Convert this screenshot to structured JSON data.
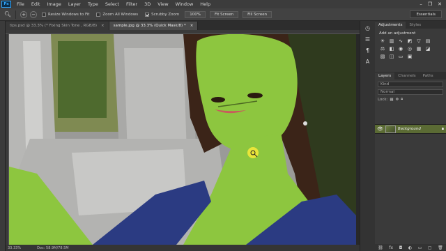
{
  "menu": {
    "logo": "Ps",
    "items": [
      "File",
      "Edit",
      "Image",
      "Layer",
      "Type",
      "Select",
      "Filter",
      "3D",
      "View",
      "Window",
      "Help"
    ],
    "window_controls": [
      "–",
      "❐",
      "✕"
    ]
  },
  "options": {
    "resize_windows": "Resize Windows to Fit",
    "zoom_all": "Zoom All Windows",
    "scrubby_zoom": "Scrubby Zoom",
    "btn_100": "100%",
    "fit_screen": "Fit Screen",
    "fill_screen": "Fill Screen",
    "workspace": "Essentials"
  },
  "tabs": [
    {
      "label": "tips.psd @ 33.3% (* Fixing Skin Tone , RGB/8)",
      "close": "×"
    },
    {
      "label": "sample.jpg @ 33.3% (Quick Mask/8) *",
      "close": "×"
    }
  ],
  "status": {
    "zoom": "33.33%",
    "doc": "Doc: 58.9M/78.5M"
  },
  "panels": {
    "adj_tabs": [
      "Adjustments",
      "Styles"
    ],
    "adj_title": "Add an adjustment",
    "layer_tabs": [
      "Layers",
      "Channels",
      "Paths"
    ],
    "kind_filter": "Kind",
    "blend_mode": "Normal",
    "opacity_label": "Opacity:",
    "lock_label": "Lock:",
    "fill_label": "Fill:",
    "layer_name": "Background"
  },
  "colors": {
    "quick_mask": "#8dc63f",
    "layer_selected": "#5b6b34"
  }
}
